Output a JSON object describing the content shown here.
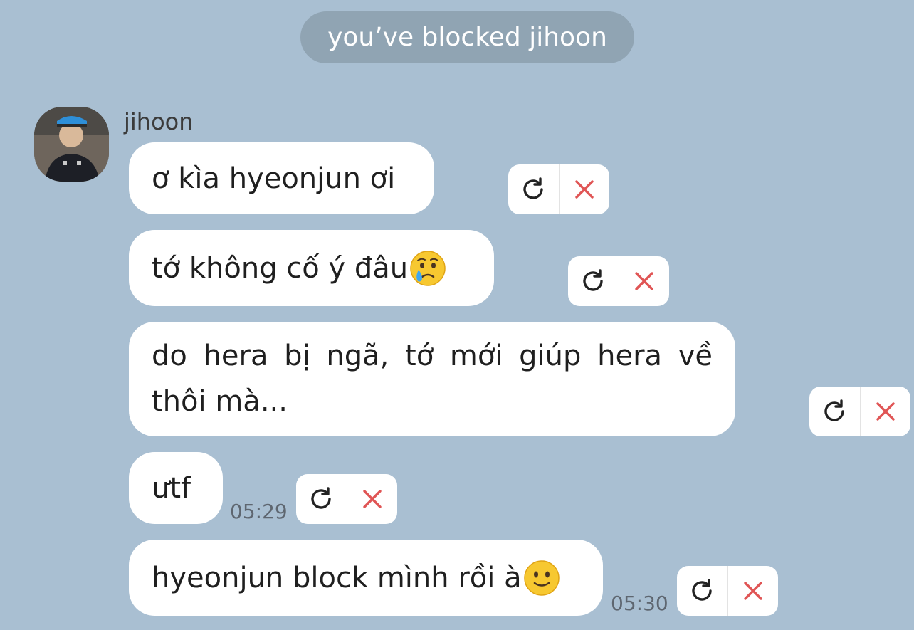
{
  "system_notice": "you’ve blocked jihoon",
  "sender": {
    "name": "jihoon"
  },
  "messages": [
    {
      "text": "ơ kìa hyeonjun ơi",
      "emoji": ""
    },
    {
      "text": "tớ không cố ý đâu",
      "emoji": "crying-face-icon"
    },
    {
      "text": "do hera bị ngã, tớ mới giúp hera về thôi mà...",
      "emoji": ""
    },
    {
      "text": "ưtf",
      "emoji": "",
      "time": "05:29"
    },
    {
      "text": "hyeonjun block mình rồi à",
      "emoji": "slightly-smiling-face-icon",
      "time": "05:30"
    }
  ],
  "colors": {
    "background": "#a9bfd2",
    "pill": "#90a4b3",
    "delete": "#e05555"
  }
}
